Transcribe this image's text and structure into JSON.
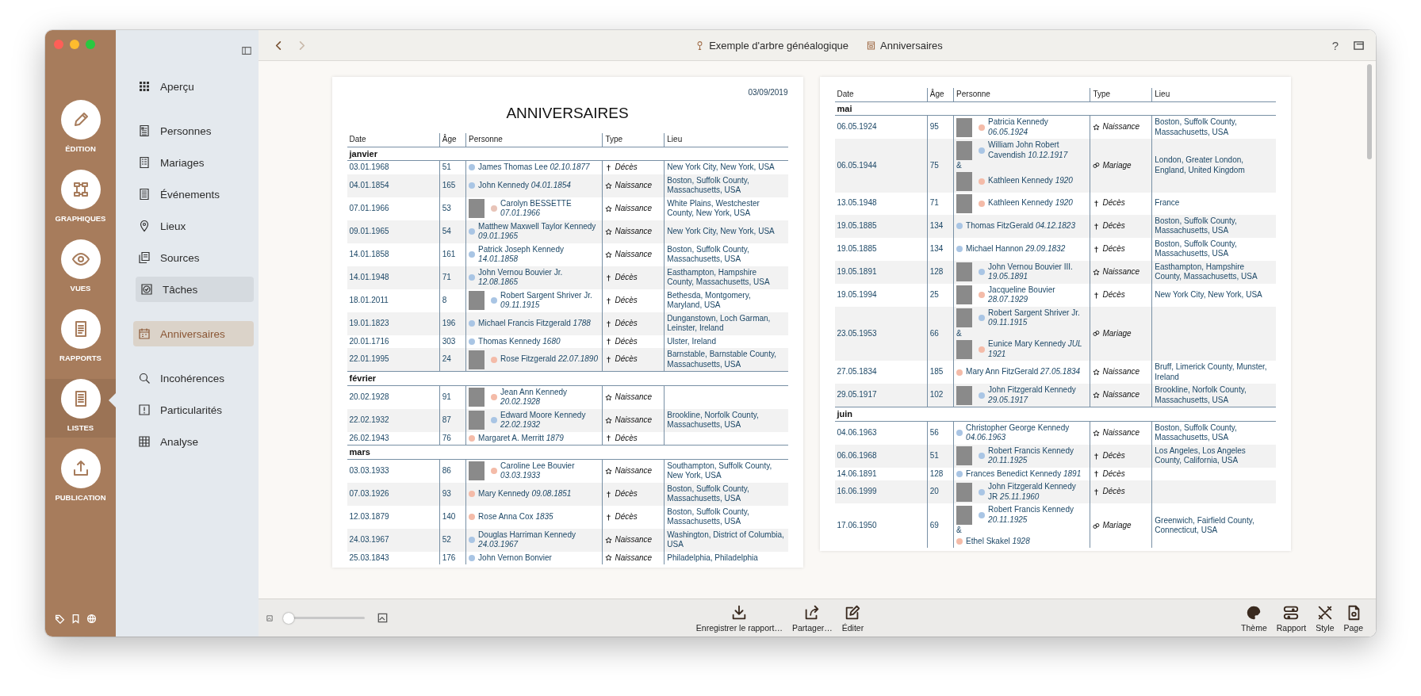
{
  "rail": {
    "items": [
      {
        "label": "ÉDITION",
        "selected": false
      },
      {
        "label": "GRAPHIQUES",
        "selected": false
      },
      {
        "label": "VUES",
        "selected": false
      },
      {
        "label": "RAPPORTS",
        "selected": false
      },
      {
        "label": "LISTES",
        "selected": true
      },
      {
        "label": "PUBLICATION",
        "selected": false
      }
    ]
  },
  "sidebar": {
    "groups": [
      {
        "items": [
          {
            "label": "Aperçu",
            "selected": false,
            "highlighted": false
          }
        ]
      },
      {
        "items": [
          {
            "label": "Personnes",
            "selected": false,
            "highlighted": false
          },
          {
            "label": "Mariages",
            "selected": false,
            "highlighted": false
          },
          {
            "label": "Événements",
            "selected": false,
            "highlighted": false
          },
          {
            "label": "Lieux",
            "selected": false,
            "highlighted": false
          },
          {
            "label": "Sources",
            "selected": false,
            "highlighted": false
          },
          {
            "label": "Tâches",
            "selected": false,
            "highlighted": true
          }
        ]
      },
      {
        "items": [
          {
            "label": "Anniversaires",
            "selected": true,
            "highlighted": false
          }
        ]
      },
      {
        "items": [
          {
            "label": "Incohérences",
            "selected": false,
            "highlighted": false
          },
          {
            "label": "Particularités",
            "selected": false,
            "highlighted": false
          },
          {
            "label": "Analyse",
            "selected": false,
            "highlighted": false
          }
        ]
      }
    ]
  },
  "topbar": {
    "nav": [
      {
        "kind": "back",
        "disabled": false
      },
      {
        "kind": "forward",
        "disabled": true
      }
    ],
    "breadcrumb": [
      {
        "label": "Exemple d'arbre généalogique"
      },
      {
        "label": "Anniversaires"
      }
    ],
    "help": "?"
  },
  "pages": [
    {
      "date": "03/09/2019",
      "title": "ANNIVERSAIRES",
      "columns": [
        "Date",
        "Âge",
        "Personne",
        "Type",
        "Lieu"
      ],
      "months": [
        {
          "name": "janvier",
          "rows": [
            {
              "date": "03.01.1968",
              "age": "51",
              "people": [
                {
                  "name": "James Thomas Lee *02.10.1877*",
                  "color": "#a9c5e4",
                  "photo": false
                }
              ],
              "type": {
                "kind": "death",
                "label": "Décès"
              },
              "place": "New York City, New York, USA"
            },
            {
              "date": "04.01.1854",
              "age": "165",
              "people": [
                {
                  "name": "John Kennedy *04.01.1854*",
                  "color": "#a9c5e4",
                  "photo": false
                }
              ],
              "type": {
                "kind": "birth",
                "label": "Naissance"
              },
              "place": "Boston, Suffolk County, Massachusetts, USA"
            },
            {
              "date": "07.01.1966",
              "age": "53",
              "people": [
                {
                  "name": "Carolyn BESSETTE *07.01.1966*",
                  "color": "#e8c4b8",
                  "photo": true
                }
              ],
              "type": {
                "kind": "birth",
                "label": "Naissance"
              },
              "place": "White Plains, Westchester County, New York, USA"
            },
            {
              "date": "09.01.1965",
              "age": "54",
              "people": [
                {
                  "name": "Matthew Maxwell Taylor Kennedy *09.01.1965*",
                  "color": "#a9c5e4",
                  "photo": false
                }
              ],
              "type": {
                "kind": "birth",
                "label": "Naissance"
              },
              "place": "New York City, New York, USA"
            },
            {
              "date": "14.01.1858",
              "age": "161",
              "people": [
                {
                  "name": "Patrick Joseph Kennedy *14.01.1858*",
                  "color": "#a9c5e4",
                  "photo": false
                }
              ],
              "type": {
                "kind": "birth",
                "label": "Naissance"
              },
              "place": "Boston, Suffolk County, Massachusetts, USA"
            },
            {
              "date": "14.01.1948",
              "age": "71",
              "people": [
                {
                  "name": "John Vernou Bouvier Jr. *12.08.1865*",
                  "color": "#a9c5e4",
                  "photo": false
                }
              ],
              "type": {
                "kind": "death",
                "label": "Décès"
              },
              "place": "Easthampton, Hampshire County, Massachusetts, USA"
            },
            {
              "date": "18.01.2011",
              "age": "8",
              "people": [
                {
                  "name": "Robert Sargent Shriver Jr. *09.11.1915*",
                  "color": "#a9c5e4",
                  "photo": true
                }
              ],
              "type": {
                "kind": "death",
                "label": "Décès"
              },
              "place": "Bethesda, Montgomery, Maryland, USA"
            },
            {
              "date": "19.01.1823",
              "age": "196",
              "people": [
                {
                  "name": "Michael Francis Fitzgerald *1788*",
                  "color": "#a9c5e4",
                  "photo": false
                }
              ],
              "type": {
                "kind": "death",
                "label": "Décès"
              },
              "place": "Dunganstown, Loch Garman, Leinster, Ireland"
            },
            {
              "date": "20.01.1716",
              "age": "303",
              "people": [
                {
                  "name": "Thomas Kennedy *1680*",
                  "color": "#a9c5e4",
                  "photo": false
                }
              ],
              "type": {
                "kind": "death",
                "label": "Décès"
              },
              "place": "Ulster, Ireland"
            },
            {
              "date": "22.01.1995",
              "age": "24",
              "people": [
                {
                  "name": "Rose Fitzgerald *22.07.1890*",
                  "color": "#f4bba8",
                  "photo": true
                }
              ],
              "type": {
                "kind": "death",
                "label": "Décès"
              },
              "place": "Barnstable, Barnstable County, Massachusetts, USA"
            }
          ]
        },
        {
          "name": "février",
          "rows": [
            {
              "date": "20.02.1928",
              "age": "91",
              "people": [
                {
                  "name": "Jean Ann Kennedy *20.02.1928*",
                  "color": "#f4bba8",
                  "photo": true
                }
              ],
              "type": {
                "kind": "birth",
                "label": "Naissance"
              }
            },
            {
              "date": "22.02.1932",
              "age": "87",
              "people": [
                {
                  "name": "Edward Moore Kennedy *22.02.1932*",
                  "color": "#a9c5e4",
                  "photo": true
                }
              ],
              "type": {
                "kind": "birth",
                "label": "Naissance"
              },
              "place": "Brookline, Norfolk County, Massachusetts, USA"
            },
            {
              "date": "26.02.1943",
              "age": "76",
              "people": [
                {
                  "name": "Margaret A. Merritt *1879*",
                  "color": "#f4bba8",
                  "photo": false
                }
              ],
              "type": {
                "kind": "death",
                "label": "Décès"
              }
            }
          ]
        },
        {
          "name": "mars",
          "rows": [
            {
              "date": "03.03.1933",
              "age": "86",
              "people": [
                {
                  "name": "Caroline Lee Bouvier *03.03.1933*",
                  "color": "#f4bba8",
                  "photo": true
                }
              ],
              "type": {
                "kind": "birth",
                "label": "Naissance"
              },
              "place": "Southampton, Suffolk County, New York, USA"
            },
            {
              "date": "07.03.1926",
              "age": "93",
              "people": [
                {
                  "name": "Mary Kennedy *09.08.1851*",
                  "color": "#f4bba8",
                  "photo": false
                }
              ],
              "type": {
                "kind": "death",
                "label": "Décès"
              },
              "place": "Boston, Suffolk County, Massachusetts, USA"
            },
            {
              "date": "12.03.1879",
              "age": "140",
              "people": [
                {
                  "name": "Rose Anna Cox *1835*",
                  "color": "#f4bba8",
                  "photo": false
                }
              ],
              "type": {
                "kind": "death",
                "label": "Décès"
              },
              "place": "Boston, Suffolk County, Massachusetts, USA"
            },
            {
              "date": "24.03.1967",
              "age": "52",
              "people": [
                {
                  "name": "Douglas Harriman Kennedy *24.03.1967*",
                  "color": "#a9c5e4",
                  "photo": false
                }
              ],
              "type": {
                "kind": "birth",
                "label": "Naissance"
              },
              "place": "Washington, District of Columbia, USA"
            },
            {
              "date": "25.03.1843",
              "age": "176",
              "people": [
                {
                  "name": "John Vernon Bonvier",
                  "color": "#a9c5e4",
                  "photo": false
                }
              ],
              "type": {
                "kind": "birth",
                "label": "Naissance"
              },
              "place": "Philadelphia, Philadelphia"
            }
          ]
        }
      ]
    },
    {
      "columns": [
        "Date",
        "Âge",
        "Personne",
        "Type",
        "Lieu"
      ],
      "months": [
        {
          "name": "mai",
          "rows": [
            {
              "date": "06.05.1924",
              "age": "95",
              "people": [
                {
                  "name": "Patricia Kennedy *06.05.1924*",
                  "color": "#f4bba8",
                  "photo": true
                }
              ],
              "type": {
                "kind": "birth",
                "label": "Naissance"
              },
              "place": "Boston, Suffolk County, Massachusetts, USA"
            },
            {
              "date": "06.05.1944",
              "age": "75",
              "people": [
                {
                  "name": "William John Robert Cavendish *10.12.1917*",
                  "color": "#a9c5e4",
                  "photo": true
                },
                {
                  "name": "Kathleen Kennedy *1920*",
                  "color": "#f4bba8",
                  "photo": true
                }
              ],
              "joiner": "&",
              "type": {
                "kind": "marriage",
                "label": "Mariage"
              },
              "place": "London, Greater London, England, United Kingdom"
            },
            {
              "date": "13.05.1948",
              "age": "71",
              "people": [
                {
                  "name": "Kathleen Kennedy *1920*",
                  "color": "#f4bba8",
                  "photo": true
                }
              ],
              "type": {
                "kind": "death",
                "label": "Décès"
              },
              "place": "France"
            },
            {
              "date": "19.05.1885",
              "age": "134",
              "people": [
                {
                  "name": "Thomas FitzGerald *04.12.1823*",
                  "color": "#a9c5e4",
                  "photo": false
                }
              ],
              "type": {
                "kind": "death",
                "label": "Décès"
              },
              "place": "Boston, Suffolk County, Massachusetts, USA"
            },
            {
              "date": "19.05.1885",
              "age": "134",
              "people": [
                {
                  "name": "Michael Hannon *29.09.1832*",
                  "color": "#a9c5e4",
                  "photo": false
                }
              ],
              "type": {
                "kind": "death",
                "label": "Décès"
              },
              "place": "Boston, Suffolk County, Massachusetts, USA"
            },
            {
              "date": "19.05.1891",
              "age": "128",
              "people": [
                {
                  "name": "John Vernou Bouvier III. *19.05.1891*",
                  "color": "#a9c5e4",
                  "photo": true
                }
              ],
              "type": {
                "kind": "birth",
                "label": "Naissance"
              },
              "place": "Easthampton, Hampshire County, Massachusetts, USA"
            },
            {
              "date": "19.05.1994",
              "age": "25",
              "people": [
                {
                  "name": "Jacqueline Bouvier *28.07.1929*",
                  "color": "#f4bba8",
                  "photo": true
                }
              ],
              "type": {
                "kind": "death",
                "label": "Décès"
              },
              "place": "New York City, New York, USA"
            },
            {
              "date": "23.05.1953",
              "age": "66",
              "people": [
                {
                  "name": "Robert Sargent Shriver Jr. *09.11.1915*",
                  "color": "#a9c5e4",
                  "photo": true
                },
                {
                  "name": "Eunice Mary Kennedy *JUL 1921*",
                  "color": "#f4bba8",
                  "photo": true
                }
              ],
              "joiner": "&",
              "type": {
                "kind": "marriage",
                "label": "Mariage"
              }
            },
            {
              "date": "27.05.1834",
              "age": "185",
              "people": [
                {
                  "name": "Mary Ann FitzGerald *27.05.1834*",
                  "color": "#f4bba8",
                  "photo": false
                }
              ],
              "type": {
                "kind": "birth",
                "label": "Naissance"
              },
              "place": "Bruff, Limerick County, Munster, Ireland"
            },
            {
              "date": "29.05.1917",
              "age": "102",
              "people": [
                {
                  "name": "John Fitzgerald Kennedy *29.05.1917*",
                  "color": "#a9c5e4",
                  "photo": true
                }
              ],
              "type": {
                "kind": "birth",
                "label": "Naissance"
              },
              "place": "Brookline, Norfolk County, Massachusetts, USA"
            }
          ]
        },
        {
          "name": "juin",
          "rows": [
            {
              "date": "04.06.1963",
              "age": "56",
              "people": [
                {
                  "name": "Christopher George Kennedy *04.06.1963*",
                  "color": "#a9c5e4",
                  "photo": false
                }
              ],
              "type": {
                "kind": "birth",
                "label": "Naissance"
              },
              "place": "Boston, Suffolk County, Massachusetts, USA"
            },
            {
              "date": "06.06.1968",
              "age": "51",
              "people": [
                {
                  "name": "Robert Francis Kennedy *20.11.1925*",
                  "color": "#a9c5e4",
                  "photo": true
                }
              ],
              "type": {
                "kind": "death",
                "label": "Décès"
              },
              "place": "Los Angeles, Los Angeles County, California, USA"
            },
            {
              "date": "14.06.1891",
              "age": "128",
              "people": [
                {
                  "name": "Frances Benedict Kennedy *1891*",
                  "color": "#a9c5e4",
                  "photo": false
                }
              ],
              "type": {
                "kind": "death",
                "label": "Décès"
              }
            },
            {
              "date": "16.06.1999",
              "age": "20",
              "people": [
                {
                  "name": "John Fitzgerald Kennedy JR *25.11.1960*",
                  "color": "#a9c5e4",
                  "photo": true
                }
              ],
              "type": {
                "kind": "death",
                "label": "Décès"
              }
            },
            {
              "date": "17.06.1950",
              "age": "69",
              "people": [
                {
                  "name": "Robert Francis Kennedy *20.11.1925*",
                  "color": "#a9c5e4",
                  "photo": true
                },
                {
                  "name": "Ethel Skakel *1928*",
                  "color": "#f4bba8",
                  "photo": false
                }
              ],
              "joiner": "&",
              "type": {
                "kind": "marriage",
                "label": "Mariage"
              },
              "place": "Greenwich, Fairfield County, Connecticut, USA"
            }
          ]
        }
      ]
    }
  ],
  "bottombar": {
    "zoom": {
      "level": 0.1
    },
    "actions": [
      {
        "label": "Enregistrer le rapport…"
      },
      {
        "label": "Partager…"
      },
      {
        "label": "Éditer"
      }
    ],
    "panels": [
      {
        "label": "Thème"
      },
      {
        "label": "Rapport"
      },
      {
        "label": "Style"
      },
      {
        "label": "Page"
      }
    ]
  }
}
